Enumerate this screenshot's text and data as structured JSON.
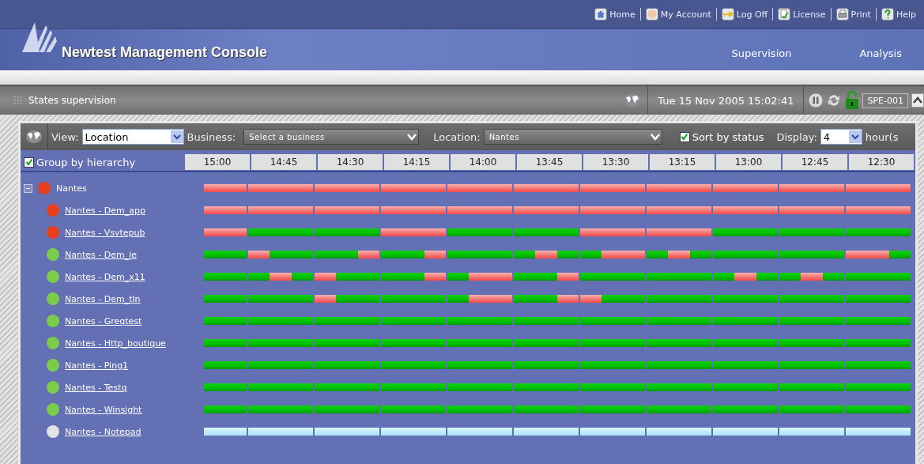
{
  "top_links": [
    {
      "kind": "home",
      "label": "Home"
    },
    {
      "kind": "account",
      "label": "My Account"
    },
    {
      "kind": "key",
      "label": "Log Off"
    },
    {
      "kind": "license",
      "label": "License"
    },
    {
      "kind": "print",
      "label": "Print"
    },
    {
      "kind": "help",
      "label": "Help"
    }
  ],
  "app_title": "Newtest Management Console",
  "main_nav": [
    "Supervision",
    "Analysis"
  ],
  "section_title": "States supervision",
  "datetime": "Tue 15 Nov 2005 15:02:41",
  "server": "SPE-001",
  "toolbar": {
    "view_label": "View:",
    "view_value": "Location",
    "business_label": "Business:",
    "business_value": "Select a business",
    "location_label": "Location:",
    "location_value": "Nantes",
    "sort_label": "Sort by status",
    "sort_checked": true,
    "display_label": "Display:",
    "display_value": "4",
    "display_unit": "hour(s"
  },
  "group": {
    "label": "Group by hierarchy",
    "checked": true
  },
  "columns": [
    "15:00",
    "14:45",
    "14:30",
    "14:15",
    "14:00",
    "13:45",
    "13:30",
    "13:15",
    "13:00",
    "12:45",
    "12:30"
  ],
  "tree": [
    {
      "name": "Nantes",
      "color": "#e8401e",
      "monitored": true,
      "expanded": true,
      "alarm": [
        [
          true,
          true
        ],
        [
          true,
          true,
          true
        ],
        [
          true,
          true,
          true
        ],
        [
          true,
          true,
          true
        ],
        [
          true,
          true,
          true
        ],
        [
          true,
          true,
          true
        ],
        [
          true,
          true,
          true
        ],
        [
          true,
          true,
          true
        ],
        [
          true,
          true,
          true
        ],
        [
          true,
          true,
          true
        ],
        [
          true,
          true,
          true
        ]
      ],
      "children": [
        {
          "name": "Nantes - Dem_app",
          "color": "#e8401e",
          "monitored": true,
          "alarm": [
            [
              true,
              true
            ],
            [
              true,
              true,
              true
            ],
            [
              true,
              true,
              true
            ],
            [
              true,
              true,
              true
            ],
            [
              true,
              true,
              true
            ],
            [
              true,
              true,
              true
            ],
            [
              true,
              true,
              true
            ],
            [
              true,
              true,
              true
            ],
            [
              true,
              true,
              true
            ],
            [
              true,
              true,
              true
            ],
            [
              true,
              true,
              true
            ]
          ]
        },
        {
          "name": "Nantes - Vsvtepub",
          "color": "#e8401e",
          "monitored": true,
          "alarm": [
            [
              true,
              true
            ],
            [
              false,
              false,
              false
            ],
            [
              false,
              false,
              false
            ],
            [
              true,
              true,
              true
            ],
            [
              false,
              false,
              false
            ],
            [
              false,
              false,
              false
            ],
            [
              true,
              true,
              true
            ],
            [
              true,
              true,
              true
            ],
            [
              false,
              false,
              false
            ],
            [
              false,
              false,
              false
            ],
            [
              false,
              false,
              false
            ]
          ]
        },
        {
          "name": "Nantes - Dem_ie",
          "color": "#7ccc4c",
          "monitored": true,
          "alarm": [
            [
              false,
              false
            ],
            [
              true,
              false,
              false
            ],
            [
              false,
              false,
              true
            ],
            [
              false,
              false,
              true
            ],
            [
              false,
              false,
              false
            ],
            [
              false,
              true,
              false
            ],
            [
              false,
              true,
              true
            ],
            [
              false,
              true,
              false
            ],
            [
              false,
              false,
              false
            ],
            [
              false,
              false,
              false
            ],
            [
              true,
              true,
              false
            ]
          ]
        },
        {
          "name": "Nantes - Dem_x11",
          "color": "#7ccc4c",
          "monitored": true,
          "alarm": [
            [
              false,
              false
            ],
            [
              false,
              true,
              false
            ],
            [
              true,
              false,
              false
            ],
            [
              false,
              false,
              true
            ],
            [
              false,
              true,
              true
            ],
            [
              false,
              false,
              true
            ],
            [
              false,
              false,
              false
            ],
            [
              false,
              false,
              false
            ],
            [
              false,
              true,
              false
            ],
            [
              false,
              true,
              false
            ],
            [
              false,
              false,
              false
            ]
          ]
        },
        {
          "name": "Nantes - Dem_tln",
          "color": "#7ccc4c",
          "monitored": true,
          "alarm": [
            [
              false,
              false
            ],
            [
              false,
              false,
              false
            ],
            [
              true,
              false,
              false
            ],
            [
              false,
              false,
              false
            ],
            [
              false,
              true,
              true
            ],
            [
              false,
              false,
              true
            ],
            [
              true,
              false,
              false
            ],
            [
              false,
              false,
              false
            ],
            [
              false,
              false,
              false
            ],
            [
              false,
              false,
              false
            ],
            [
              false,
              false,
              false
            ]
          ]
        },
        {
          "name": "Nantes - Greqtest",
          "color": "#7ccc4c",
          "monitored": true,
          "alarm": [
            [
              false,
              false
            ],
            [
              false,
              false,
              false
            ],
            [
              false,
              false,
              false
            ],
            [
              false,
              false,
              false
            ],
            [
              false,
              false,
              false
            ],
            [
              false,
              false,
              false
            ],
            [
              false,
              false,
              false
            ],
            [
              false,
              false,
              false
            ],
            [
              false,
              false,
              false
            ],
            [
              false,
              false,
              false
            ],
            [
              false,
              false,
              false
            ]
          ]
        },
        {
          "name": "Nantes - Http_boutique",
          "color": "#7ccc4c",
          "monitored": true,
          "alarm": [
            [
              false,
              false
            ],
            [
              false,
              false,
              false
            ],
            [
              false,
              false,
              false
            ],
            [
              false,
              false,
              false
            ],
            [
              false,
              false,
              false
            ],
            [
              false,
              false,
              false
            ],
            [
              false,
              false,
              false
            ],
            [
              false,
              false,
              false
            ],
            [
              false,
              false,
              false
            ],
            [
              false,
              false,
              false
            ],
            [
              false,
              false,
              false
            ]
          ]
        },
        {
          "name": "Nantes - Ping1",
          "color": "#7ccc4c",
          "monitored": true,
          "alarm": [
            [
              false,
              false
            ],
            [
              false,
              false,
              false
            ],
            [
              false,
              false,
              false
            ],
            [
              false,
              false,
              false
            ],
            [
              false,
              false,
              false
            ],
            [
              false,
              false,
              false
            ],
            [
              false,
              false,
              false
            ],
            [
              false,
              false,
              false
            ],
            [
              false,
              false,
              false
            ],
            [
              false,
              false,
              false
            ],
            [
              false,
              false,
              false
            ]
          ]
        },
        {
          "name": "Nantes - Testq",
          "color": "#7ccc4c",
          "monitored": true,
          "alarm": [
            [
              false,
              false
            ],
            [
              false,
              false,
              false
            ],
            [
              false,
              false,
              false
            ],
            [
              false,
              false,
              false
            ],
            [
              false,
              false,
              false
            ],
            [
              false,
              false,
              false
            ],
            [
              false,
              false,
              false
            ],
            [
              false,
              false,
              false
            ],
            [
              false,
              false,
              false
            ],
            [
              false,
              false,
              false
            ],
            [
              false,
              false,
              false
            ]
          ]
        },
        {
          "name": "Nantes - Winsight",
          "color": "#7ccc4c",
          "monitored": true,
          "alarm": [
            [
              false,
              false
            ],
            [
              false,
              false,
              false
            ],
            [
              false,
              false,
              false
            ],
            [
              false,
              false,
              false
            ],
            [
              false,
              false,
              false
            ],
            [
              false,
              false,
              false
            ],
            [
              false,
              false,
              false
            ],
            [
              false,
              false,
              false
            ],
            [
              false,
              false,
              false
            ],
            [
              false,
              false,
              false
            ],
            [
              false,
              false,
              false
            ]
          ]
        },
        {
          "name": "Nantes - Notepad",
          "color": "#e4e4e4",
          "monitored": false
        }
      ]
    }
  ]
}
